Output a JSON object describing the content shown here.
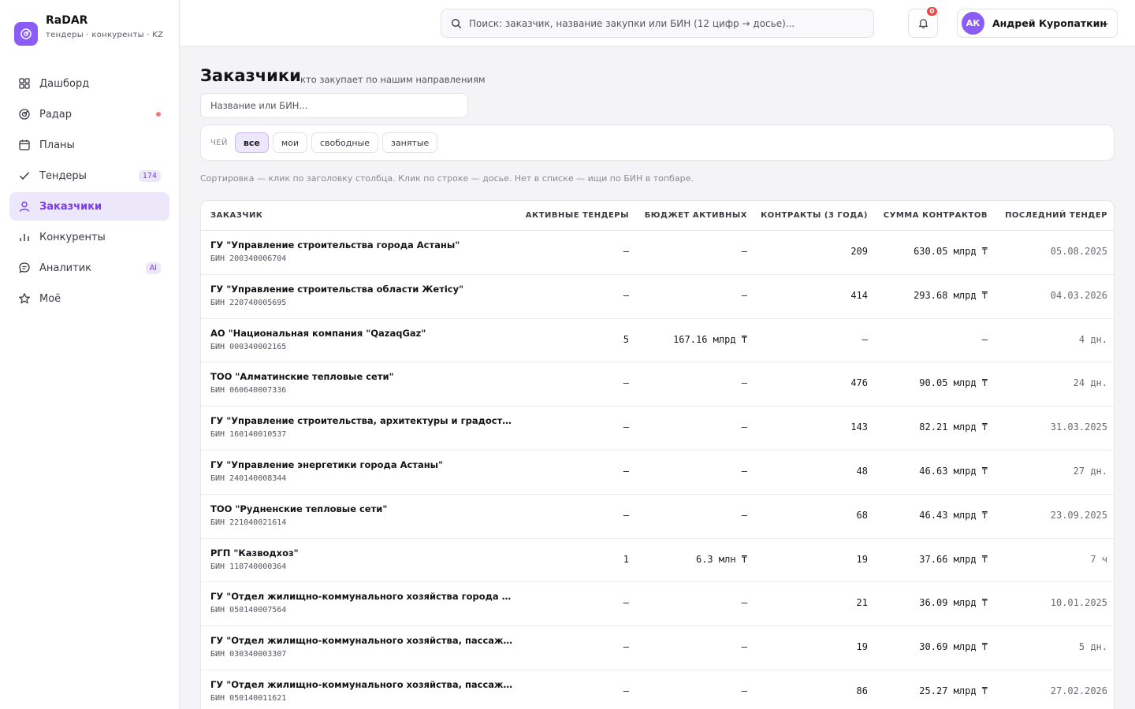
{
  "brand": {
    "title": "RaDAR",
    "subtitle": "тендеры · конкуренты · KZ",
    "accent": "#8b5cf6"
  },
  "sidebar": {
    "items": [
      {
        "label": "Дашборд",
        "icon": "grid-icon"
      },
      {
        "label": "Радар",
        "icon": "radar-icon",
        "dot": true
      },
      {
        "label": "Планы",
        "icon": "calendar-icon"
      },
      {
        "label": "Тендеры",
        "icon": "check-icon",
        "badge": "174"
      },
      {
        "label": "Заказчики",
        "icon": "user-icon",
        "active": true
      },
      {
        "label": "Конкуренты",
        "icon": "bar-chart-icon"
      },
      {
        "label": "Аналитик",
        "icon": "chat-icon",
        "badge": "AI"
      },
      {
        "label": "Моё",
        "icon": "star-icon"
      }
    ]
  },
  "topbar": {
    "search_placeholder": "Поиск: заказчик, название закупки или БИН (12 цифр → досье)...",
    "notifications_count": "0",
    "user": {
      "initials": "АК",
      "name": "Андрей Куропаткин"
    }
  },
  "page": {
    "title": "Заказчики",
    "subtitle": "кто закупает по нашим направлениям",
    "filter_placeholder": "Название или БИН...",
    "chips_label": "ЧЕЙ",
    "chips": [
      "все",
      "мои",
      "свободные",
      "занятые"
    ],
    "active_chip": "все",
    "hint": "Сортировка — клик по заголовку столбца. Клик по строке — досье. Нет в списке — ищи по БИН в топбаре."
  },
  "table": {
    "columns": [
      "ЗАКАЗЧИК",
      "АКТИВНЫЕ ТЕНДЕРЫ",
      "БЮДЖЕТ АКТИВНЫХ",
      "КОНТРАКТЫ (3 ГОДА)",
      "СУММА КОНТРАКТОВ",
      "ПОСЛЕДНИЙ ТЕНДЕР"
    ],
    "rows": [
      {
        "name": "ГУ \"Управление строительства города Астаны\"",
        "bin": "БИН 200340006704",
        "active": "–",
        "budget": "–",
        "contracts": "209",
        "sum": "630.05 млрд ₸",
        "last": "05.08.2025"
      },
      {
        "name": "ГУ \"Управление строительства области Жетісу\"",
        "bin": "БИН 220740005695",
        "active": "–",
        "budget": "–",
        "contracts": "414",
        "sum": "293.68 млрд ₸",
        "last": "04.03.2026"
      },
      {
        "name": "АО \"Национальная компания \"QazaqGaz\"",
        "bin": "БИН 000340002165",
        "active": "5",
        "budget": "167.16 млрд ₸",
        "contracts": "–",
        "sum": "–",
        "last": "4 дн."
      },
      {
        "name": "ТОО \"Алматинские тепловые сети\"",
        "bin": "БИН 060640007336",
        "active": "–",
        "budget": "–",
        "contracts": "476",
        "sum": "90.05 млрд ₸",
        "last": "24 дн."
      },
      {
        "name": "ГУ \"Управление строительства, архитектуры и градостр...",
        "bin": "БИН 160140010537",
        "active": "–",
        "budget": "–",
        "contracts": "143",
        "sum": "82.21 млрд ₸",
        "last": "31.03.2025"
      },
      {
        "name": "ГУ \"Управление энергетики города Астаны\"",
        "bin": "БИН 240140008344",
        "active": "–",
        "budget": "–",
        "contracts": "48",
        "sum": "46.63 млрд ₸",
        "last": "27 дн."
      },
      {
        "name": "ТОО \"Рудненские тепловые сети\"",
        "bin": "БИН 221040021614",
        "active": "–",
        "budget": "–",
        "contracts": "68",
        "sum": "46.43 млрд ₸",
        "last": "23.09.2025"
      },
      {
        "name": "РГП \"Казводхоз\"",
        "bin": "БИН 110740000364",
        "active": "1",
        "budget": "6.3 млн ₸",
        "contracts": "19",
        "sum": "37.66 млрд ₸",
        "last": "7 ч"
      },
      {
        "name": "ГУ \"Отдел жилищно-коммунального хозяйства города Ж...",
        "bin": "БИН 050140007564",
        "active": "–",
        "budget": "–",
        "contracts": "21",
        "sum": "36.09 млрд ₸",
        "last": "10.01.2025"
      },
      {
        "name": "ГУ \"Отдел жилищно-коммунального хозяйства, пассажи...",
        "bin": "БИН 030340003307",
        "active": "–",
        "budget": "–",
        "contracts": "19",
        "sum": "30.69 млрд ₸",
        "last": "5 дн."
      },
      {
        "name": "ГУ \"Отдел жилищно-коммунального хозяйства, пассажи...",
        "bin": "БИН 050140011621",
        "active": "–",
        "budget": "–",
        "contracts": "86",
        "sum": "25.27 млрд ₸",
        "last": "27.02.2026"
      }
    ]
  }
}
